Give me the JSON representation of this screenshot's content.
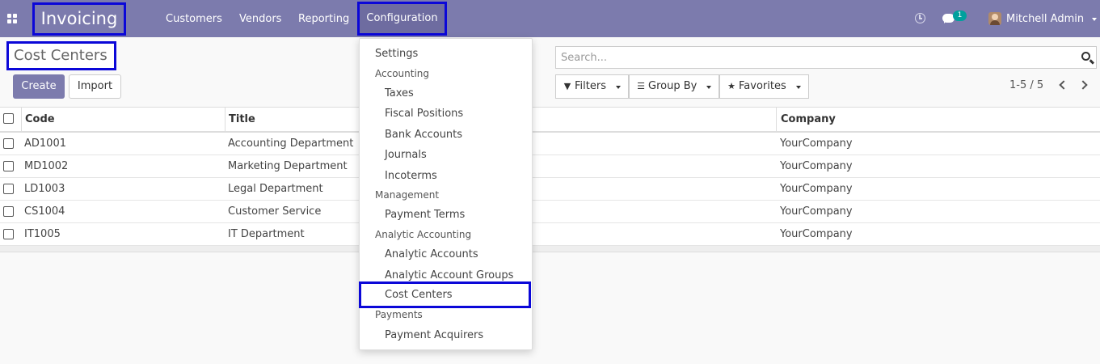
{
  "navbar": {
    "brand": "Invoicing",
    "menu": [
      "Customers",
      "Vendors",
      "Reporting"
    ],
    "active_menu": "Configuration",
    "notifications_count": "1",
    "user": "Mitchell Admin"
  },
  "control_panel": {
    "title": "Cost Centers",
    "create_label": "Create",
    "import_label": "Import",
    "search_placeholder": "Search...",
    "filters_label": "Filters",
    "group_by_label": "Group By",
    "favorites_label": "Favorites",
    "pager": "1-5 / 5"
  },
  "table": {
    "columns": [
      "Code",
      "Title",
      "Company"
    ],
    "rows": [
      [
        "AD1001",
        "Accounting Department",
        "YourCompany"
      ],
      [
        "MD1002",
        "Marketing Department",
        "YourCompany"
      ],
      [
        "LD1003",
        "Legal Department",
        "YourCompany"
      ],
      [
        "CS1004",
        "Customer Service",
        "YourCompany"
      ],
      [
        "IT1005",
        "IT Department",
        "YourCompany"
      ]
    ]
  },
  "config_menu": {
    "settings": "Settings",
    "accounting_header": "Accounting",
    "accounting_items": [
      "Taxes",
      "Fiscal Positions",
      "Bank Accounts",
      "Journals",
      "Incoterms"
    ],
    "management_header": "Management",
    "management_items": [
      "Payment Terms"
    ],
    "analytic_header": "Analytic Accounting",
    "analytic_items": [
      "Analytic Accounts",
      "Analytic Account Groups",
      "Cost Centers"
    ],
    "payments_header": "Payments",
    "payments_items": [
      "Payment Acquirers"
    ]
  },
  "colors": {
    "navbar": "#7c7bad",
    "primary_button": "#7c7bad",
    "highlight_box": "#0b07d8",
    "badge": "#00a09d"
  }
}
